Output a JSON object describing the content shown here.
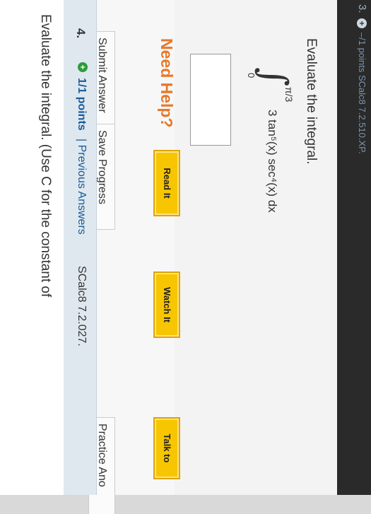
{
  "question3": {
    "number": "3.",
    "points_text": "–/1 points  SCalc8 7.2.510.XP.",
    "prompt": "Evaluate the integral.",
    "integral": {
      "upper_limit": "π/3",
      "lower_limit": "0",
      "integrand": "3 tan⁵(x) sec⁴(x) dx"
    },
    "need_help_label": "Need Help?",
    "help_buttons": [
      "Read It",
      "Watch It",
      "Talk to"
    ],
    "actions": {
      "submit": "Submit Answer",
      "save": "Save Progress",
      "practice": "Practice Ano"
    }
  },
  "question4": {
    "number": "4.",
    "points": "1/1 points",
    "previous": "| Previous Answers",
    "source": "SCalc8 7.2.027.",
    "prompt": "Evaluate the integral. (Use C for the constant of"
  }
}
